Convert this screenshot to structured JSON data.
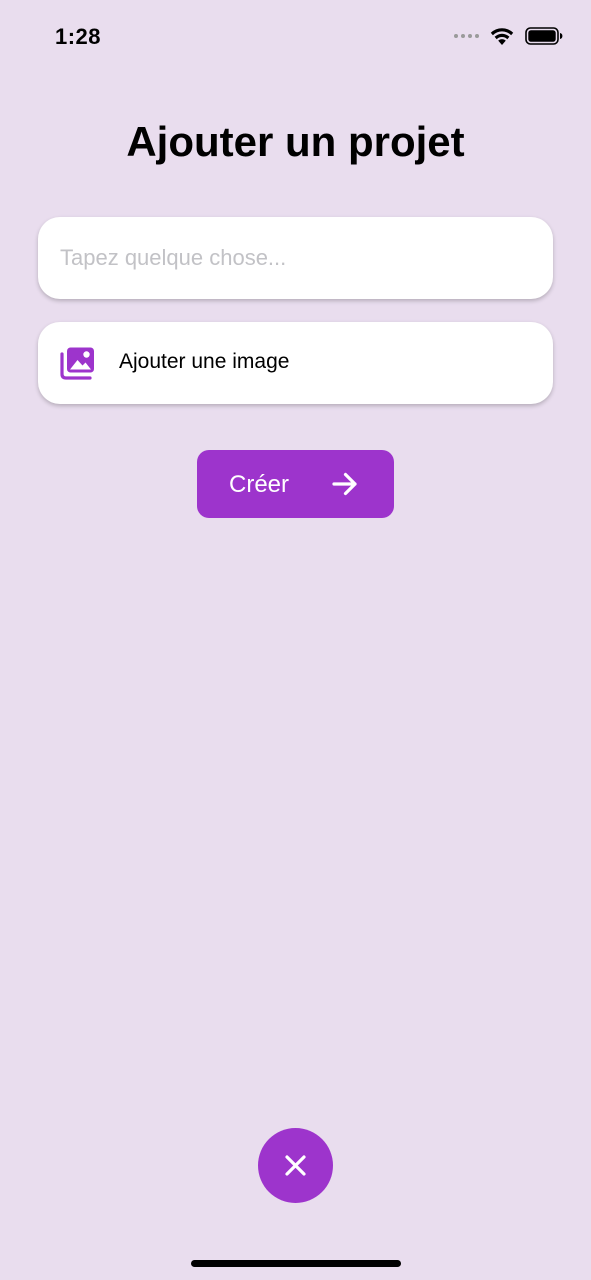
{
  "status_bar": {
    "time": "1:28",
    "icons": [
      "signal-dots-icon",
      "wifi-icon",
      "battery-icon"
    ]
  },
  "title": "Ajouter un projet",
  "text_input": {
    "placeholder": "Tapez quelque chose...",
    "value": ""
  },
  "image_picker": {
    "label": "Ajouter une image",
    "icon": "images-icon"
  },
  "create_button": {
    "label": "Créer",
    "icon": "arrow-right-icon"
  },
  "close_button": {
    "icon": "close-icon"
  },
  "colors": {
    "background": "#e9ddee",
    "accent": "#9d34cc",
    "card": "#ffffff",
    "placeholder": "#c2c2c6"
  }
}
